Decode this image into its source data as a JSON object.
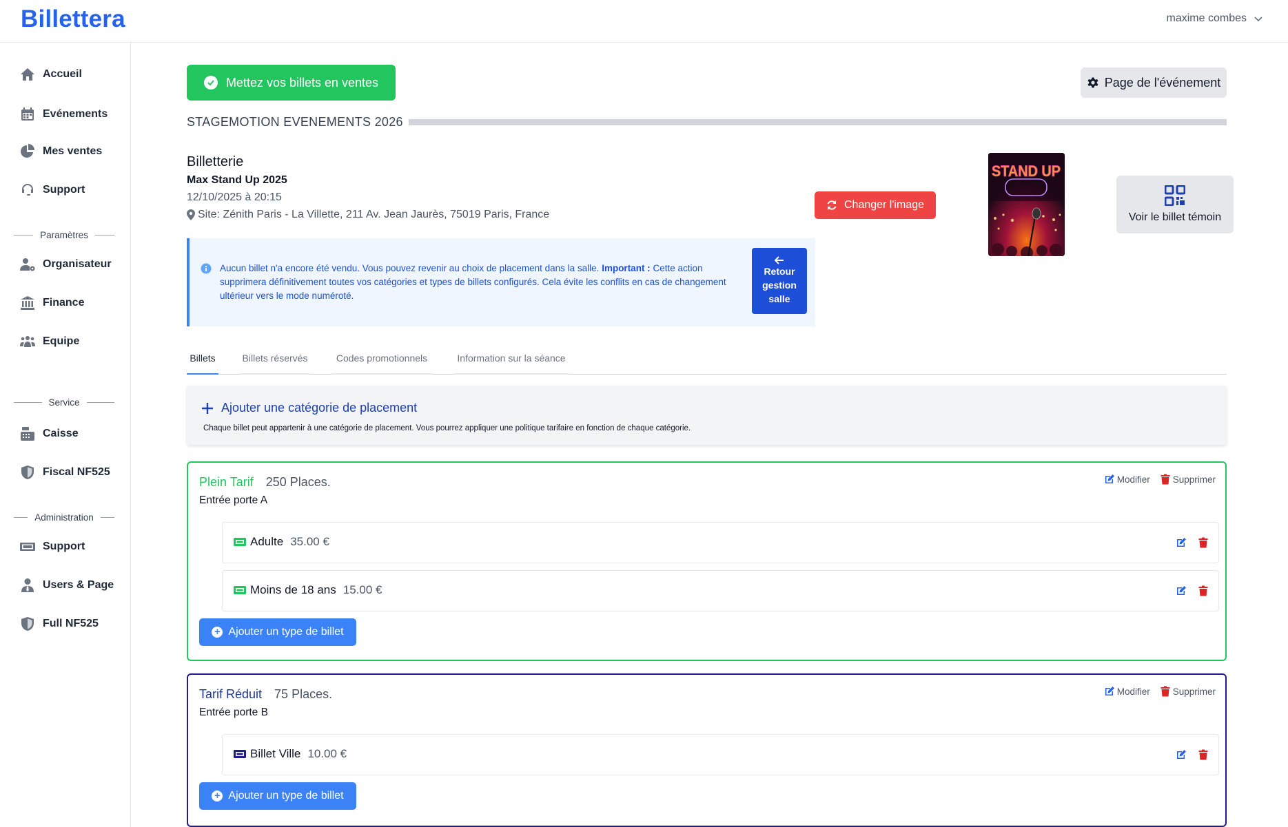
{
  "app": {
    "brand": "Billettera",
    "user_name": "maxime combes"
  },
  "sidebar": {
    "items": [
      {
        "label": "Accueil",
        "icon": "home-icon"
      },
      {
        "label": "Evénements",
        "icon": "calendar-icon"
      },
      {
        "label": "Mes ventes",
        "icon": "pie-chart-icon"
      },
      {
        "label": "Support",
        "icon": "headset-icon"
      }
    ],
    "section_parametres": "Paramètres",
    "parametres_items": [
      {
        "label": "Organisateur",
        "icon": "user-gear-icon"
      },
      {
        "label": "Finance",
        "icon": "bank-icon"
      },
      {
        "label": "Equipe",
        "icon": "team-icon"
      }
    ],
    "section_service": "Service",
    "service_items": [
      {
        "label": "Caisse",
        "icon": "cash-register-icon"
      },
      {
        "label": "Fiscal NF525",
        "icon": "shield-icon"
      }
    ],
    "section_admin": "Administration",
    "admin_items": [
      {
        "label": "Support",
        "icon": "ticket-icon"
      },
      {
        "label": "Users & Page",
        "icon": "user-tie-icon"
      },
      {
        "label": "Full NF525",
        "icon": "shield-icon"
      }
    ]
  },
  "main": {
    "sell_button": "Mettez vos billets en ventes",
    "event_page_button": "Page de l'événement",
    "event_header": "STAGEMOTION EVENEMENTS 2026",
    "info": {
      "heading": "Billetterie",
      "event_name": "Max Stand Up 2025",
      "date": "12/10/2025 à 20:15",
      "site": "Site: Zénith Paris - La Villette, 211 Av. Jean Jaurès, 75019 Paris, France"
    },
    "change_image_button": "Changer l'image",
    "poster_text": "STAND UP",
    "view_ticket_button": "Voir le billet témoin",
    "alert": {
      "text_before": "Aucun billet n'a encore été vendu. Vous pouvez revenir au choix de placement dans la salle. ",
      "important": "Important :",
      "text_after": " Cette action supprimera définitivement toutes vos catégories et types de billets configurés. Cela évite les conflits en cas de changement ultérieur vers le mode numéroté.",
      "button_line1": "Retour",
      "button_line2": "gestion",
      "button_line3": "salle"
    },
    "tabs": [
      "Billets",
      "Billets réservés",
      "Codes promotionnels",
      "Information sur la séance"
    ],
    "add_category": {
      "label": "Ajouter une catégorie de placement",
      "description": "Chaque billet peut appartenir à une catégorie de placement. Vous pourrez appliquer une politique tarifaire en fonction de chaque catégorie."
    },
    "actions": {
      "modify": "Modifier",
      "delete": "Supprimer"
    },
    "add_ticket_type": "Ajouter un type de billet",
    "categories": [
      {
        "name": "Plein Tarif",
        "places": "250 Places.",
        "door": "Entrée porte A",
        "color": "#22c55e",
        "tickets": [
          {
            "name": "Adulte",
            "price": "35.00 €"
          },
          {
            "name": "Moins de 18 ans",
            "price": "15.00 €"
          }
        ]
      },
      {
        "name": "Tarif Réduit",
        "places": "75 Places.",
        "door": "Entrée porte B",
        "color": "#1e1b8a",
        "tickets": [
          {
            "name": "Billet Ville",
            "price": "10.00 €"
          }
        ]
      }
    ]
  }
}
